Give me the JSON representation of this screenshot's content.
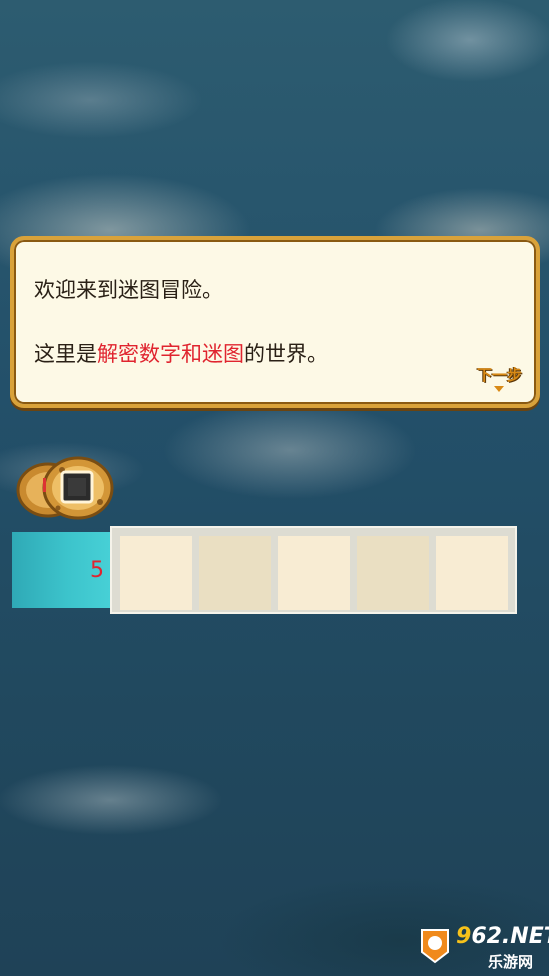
{
  "dialog": {
    "line1": "欢迎来到迷图冒险。",
    "line2_prefix": "这里是",
    "line2_highlight": "解密数字和迷图",
    "line2_suffix": "的世界。",
    "next_label": "下一步"
  },
  "item": {
    "icon": "cookie-with-square-icon"
  },
  "puzzle_row": {
    "clue": "5",
    "cells": [
      "",
      "",
      "",
      "",
      ""
    ]
  },
  "watermark": {
    "brand_prefix": "9",
    "brand_main": "62.NET",
    "brand_sub": "乐游网"
  },
  "colors": {
    "highlight": "#e0242f",
    "dialog_border": "#d9a23a",
    "clue_bg": "#3cc3cb"
  }
}
